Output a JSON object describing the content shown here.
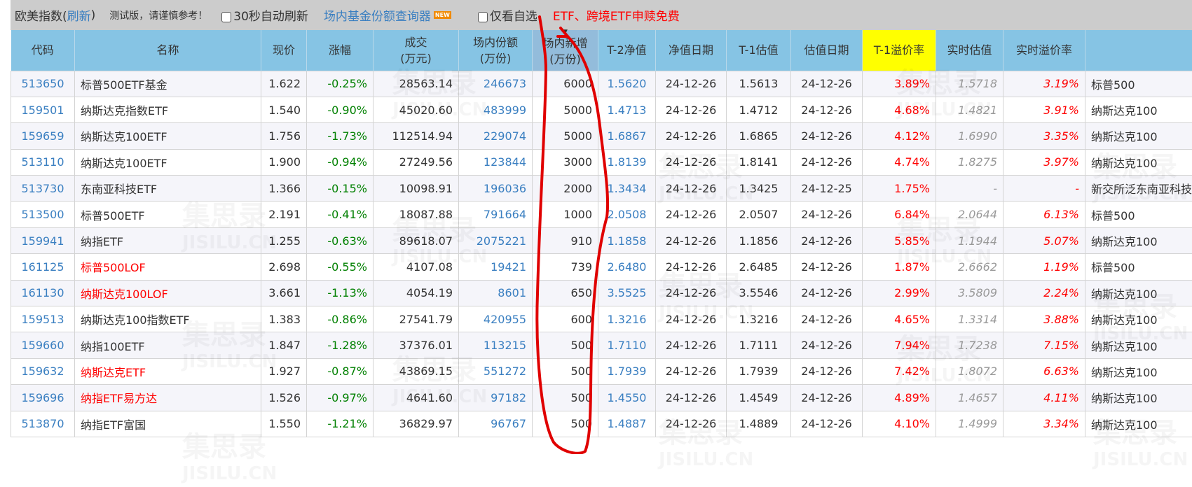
{
  "topbar": {
    "title": "欧美指数(",
    "refresh": "刷新",
    "title_end": ")",
    "notice": "测试版，请谨慎参考！",
    "auto_refresh": "30秒自动刷新",
    "share_query": "场内基金份额查询器",
    "new_badge": "NEW",
    "watchlist_only": "仅看自选",
    "promo": "ETF、跨境ETF申赎免费"
  },
  "watermark": {
    "cn": "集思录",
    "en": "JISILU.CN"
  },
  "colors": {
    "header": "#86c4e4",
    "highlight_header": "#ffff00",
    "up": "#ff0000",
    "down": "#008000",
    "link": "#3a7fc1",
    "annotation": "#e00000"
  },
  "sort": {
    "column": "场内新增",
    "direction": "down",
    "icon": "sort-down-triangle-icon"
  },
  "columns": [
    {
      "l1": "代码",
      "l2": ""
    },
    {
      "l1": "名称",
      "l2": ""
    },
    {
      "l1": "现价",
      "l2": ""
    },
    {
      "l1": "涨幅",
      "l2": ""
    },
    {
      "l1": "成交",
      "l2": "(万元)"
    },
    {
      "l1": "场内份额",
      "l2": "(万份)"
    },
    {
      "l1": "场内新增",
      "l2": "(万份)"
    },
    {
      "l1": "T-2净值",
      "l2": ""
    },
    {
      "l1": "净值日期",
      "l2": ""
    },
    {
      "l1": "T-1估值",
      "l2": ""
    },
    {
      "l1": "估值日期",
      "l2": ""
    },
    {
      "l1": "T-1溢价率",
      "l2": ""
    },
    {
      "l1": "实时估值",
      "l2": ""
    },
    {
      "l1": "实时溢价率",
      "l2": ""
    },
    {
      "l1": "",
      "l2": ""
    }
  ],
  "rows": [
    {
      "code": "513650",
      "name": "标普500ETF基金",
      "name_red": false,
      "price": "1.622",
      "chg": "-0.25%",
      "vol": "28563.14",
      "shares": "246673",
      "new": "6000",
      "nav2": "1.5620",
      "navdate": "24-12-26",
      "est1": "1.5613",
      "estdate": "24-12-26",
      "prem1": "3.89%",
      "rt_est": "1.5718",
      "rt_prem": "3.19%",
      "index": "标普500"
    },
    {
      "code": "159501",
      "name": "纳斯达克指数ETF",
      "name_red": false,
      "price": "1.540",
      "chg": "-0.90%",
      "vol": "45020.60",
      "shares": "483999",
      "new": "5000",
      "nav2": "1.4713",
      "navdate": "24-12-26",
      "est1": "1.4712",
      "estdate": "24-12-26",
      "prem1": "4.68%",
      "rt_est": "1.4821",
      "rt_prem": "3.91%",
      "index": "纳斯达克100"
    },
    {
      "code": "159659",
      "name": "纳斯达克100ETF",
      "name_red": false,
      "price": "1.756",
      "chg": "-1.73%",
      "vol": "112514.94",
      "shares": "229074",
      "new": "5000",
      "nav2": "1.6867",
      "navdate": "24-12-26",
      "est1": "1.6865",
      "estdate": "24-12-26",
      "prem1": "4.12%",
      "rt_est": "1.6990",
      "rt_prem": "3.35%",
      "index": "纳斯达克100"
    },
    {
      "code": "513110",
      "name": "纳斯达克100ETF",
      "name_red": false,
      "price": "1.900",
      "chg": "-0.94%",
      "vol": "27249.56",
      "shares": "123844",
      "new": "3000",
      "nav2": "1.8139",
      "navdate": "24-12-26",
      "est1": "1.8141",
      "estdate": "24-12-26",
      "prem1": "4.74%",
      "rt_est": "1.8275",
      "rt_prem": "3.97%",
      "index": "纳斯达克100"
    },
    {
      "code": "513730",
      "name": "东南亚科技ETF",
      "name_red": false,
      "price": "1.366",
      "chg": "-0.15%",
      "vol": "10098.91",
      "shares": "196036",
      "new": "2000",
      "nav2": "1.3434",
      "navdate": "24-12-26",
      "est1": "1.3425",
      "estdate": "24-12-25",
      "prem1": "1.75%",
      "rt_est": "-",
      "rt_prem": "-",
      "index": "新交所泛东南亚科技"
    },
    {
      "code": "513500",
      "name": "标普500ETF",
      "name_red": false,
      "price": "2.191",
      "chg": "-0.41%",
      "vol": "18087.88",
      "shares": "791664",
      "new": "1000",
      "nav2": "2.0508",
      "navdate": "24-12-26",
      "est1": "2.0507",
      "estdate": "24-12-26",
      "prem1": "6.84%",
      "rt_est": "2.0644",
      "rt_prem": "6.13%",
      "index": "标普500"
    },
    {
      "code": "159941",
      "name": "纳指ETF",
      "name_red": false,
      "price": "1.255",
      "chg": "-0.63%",
      "vol": "89618.07",
      "shares": "2075221",
      "new": "910",
      "nav2": "1.1858",
      "navdate": "24-12-26",
      "est1": "1.1856",
      "estdate": "24-12-26",
      "prem1": "5.85%",
      "rt_est": "1.1944",
      "rt_prem": "5.07%",
      "index": "纳斯达克100"
    },
    {
      "code": "161125",
      "name": "标普500LOF",
      "name_red": true,
      "price": "2.698",
      "chg": "-0.55%",
      "vol": "4107.08",
      "shares": "19421",
      "new": "739",
      "nav2": "2.6480",
      "navdate": "24-12-26",
      "est1": "2.6485",
      "estdate": "24-12-26",
      "prem1": "1.87%",
      "rt_est": "2.6662",
      "rt_prem": "1.19%",
      "index": "标普500"
    },
    {
      "code": "161130",
      "name": "纳斯达克100LOF",
      "name_red": true,
      "price": "3.661",
      "chg": "-1.13%",
      "vol": "4054.19",
      "shares": "8601",
      "new": "650",
      "nav2": "3.5525",
      "navdate": "24-12-26",
      "est1": "3.5546",
      "estdate": "24-12-26",
      "prem1": "2.99%",
      "rt_est": "3.5809",
      "rt_prem": "2.24%",
      "index": "纳斯达克100"
    },
    {
      "code": "159513",
      "name": "纳斯达克100指数ETF",
      "name_red": false,
      "price": "1.383",
      "chg": "-0.86%",
      "vol": "27541.79",
      "shares": "420955",
      "new": "600",
      "nav2": "1.3216",
      "navdate": "24-12-26",
      "est1": "1.3216",
      "estdate": "24-12-26",
      "prem1": "4.65%",
      "rt_est": "1.3314",
      "rt_prem": "3.88%",
      "index": "纳斯达克100"
    },
    {
      "code": "159660",
      "name": "纳指100ETF",
      "name_red": false,
      "price": "1.847",
      "chg": "-1.28%",
      "vol": "37376.01",
      "shares": "113215",
      "new": "500",
      "nav2": "1.7110",
      "navdate": "24-12-26",
      "est1": "1.7111",
      "estdate": "24-12-26",
      "prem1": "7.94%",
      "rt_est": "1.7238",
      "rt_prem": "7.15%",
      "index": "纳斯达克100"
    },
    {
      "code": "159632",
      "name": "纳斯达克ETF",
      "name_red": true,
      "price": "1.927",
      "chg": "-0.87%",
      "vol": "43869.15",
      "shares": "551272",
      "new": "500",
      "nav2": "1.7939",
      "navdate": "24-12-26",
      "est1": "1.7939",
      "estdate": "24-12-26",
      "prem1": "7.42%",
      "rt_est": "1.8072",
      "rt_prem": "6.63%",
      "index": "纳斯达克100"
    },
    {
      "code": "159696",
      "name": "纳指ETF易方达",
      "name_red": true,
      "price": "1.526",
      "chg": "-0.97%",
      "vol": "4641.60",
      "shares": "97182",
      "new": "500",
      "nav2": "1.4550",
      "navdate": "24-12-26",
      "est1": "1.4549",
      "estdate": "24-12-26",
      "prem1": "4.89%",
      "rt_est": "1.4657",
      "rt_prem": "4.11%",
      "index": "纳斯达克100"
    },
    {
      "code": "513870",
      "name": "纳指ETF富国",
      "name_red": false,
      "price": "1.550",
      "chg": "-1.21%",
      "vol": "36829.97",
      "shares": "96767",
      "new": "500",
      "nav2": "1.4887",
      "navdate": "24-12-26",
      "est1": "1.4889",
      "estdate": "24-12-26",
      "prem1": "4.10%",
      "rt_est": "1.4999",
      "rt_prem": "3.34%",
      "index": "纳斯达克100"
    }
  ]
}
